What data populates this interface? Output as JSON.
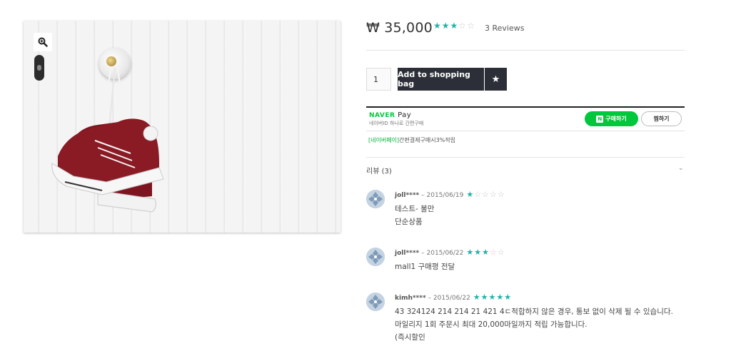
{
  "product": {
    "price": "₩ 35,000",
    "rating_stars": [
      true,
      true,
      true,
      false,
      false
    ],
    "reviews_label": "3 Reviews",
    "quantity": "1",
    "add_to_bag_label": "Add to shopping bag"
  },
  "naver_pay": {
    "brand": "NAVER",
    "pay": "Pay",
    "subtitle": "네이버ID 하나로 간편구매",
    "buy_label": "구매하기",
    "buy_icon_letter": "N",
    "wish_label": "찜하기",
    "promo_highlight": "[네이버페이]",
    "promo_text": "간편결제구매시3%적립"
  },
  "reviews": {
    "header": "리뷰 (3)",
    "items": [
      {
        "author": "joll****",
        "date": "– 2015/06/19",
        "stars": [
          true,
          false,
          false,
          false,
          false
        ],
        "lines": [
          "테스트- 불만",
          "단순상품"
        ]
      },
      {
        "author": "joll****",
        "date": "– 2015/06/22",
        "stars": [
          true,
          true,
          true,
          false,
          false
        ],
        "lines": [
          "mall1 구매평 전달"
        ]
      },
      {
        "author": "kimh****",
        "date": "– 2015/06/22",
        "stars": [
          true,
          true,
          true,
          true,
          true
        ],
        "lines": [
          "43 324124 214 214 21 421 4ㄷ적합하지 않은 경우, 통보 없이 삭제 될 수 있습니다.",
          "마일리지 1회 주문시 최대 20,000마일까지 적립 가능합니다.",
          "(즉시할인"
        ]
      }
    ]
  },
  "colors": {
    "accent": "#1cb5a6",
    "button_dark": "#2c2f38",
    "naver_green": "#00c73c"
  },
  "icons": {
    "zoom": "zoom-icon",
    "wishlist_star": "star-icon",
    "chevron": "chevron-down-icon"
  }
}
